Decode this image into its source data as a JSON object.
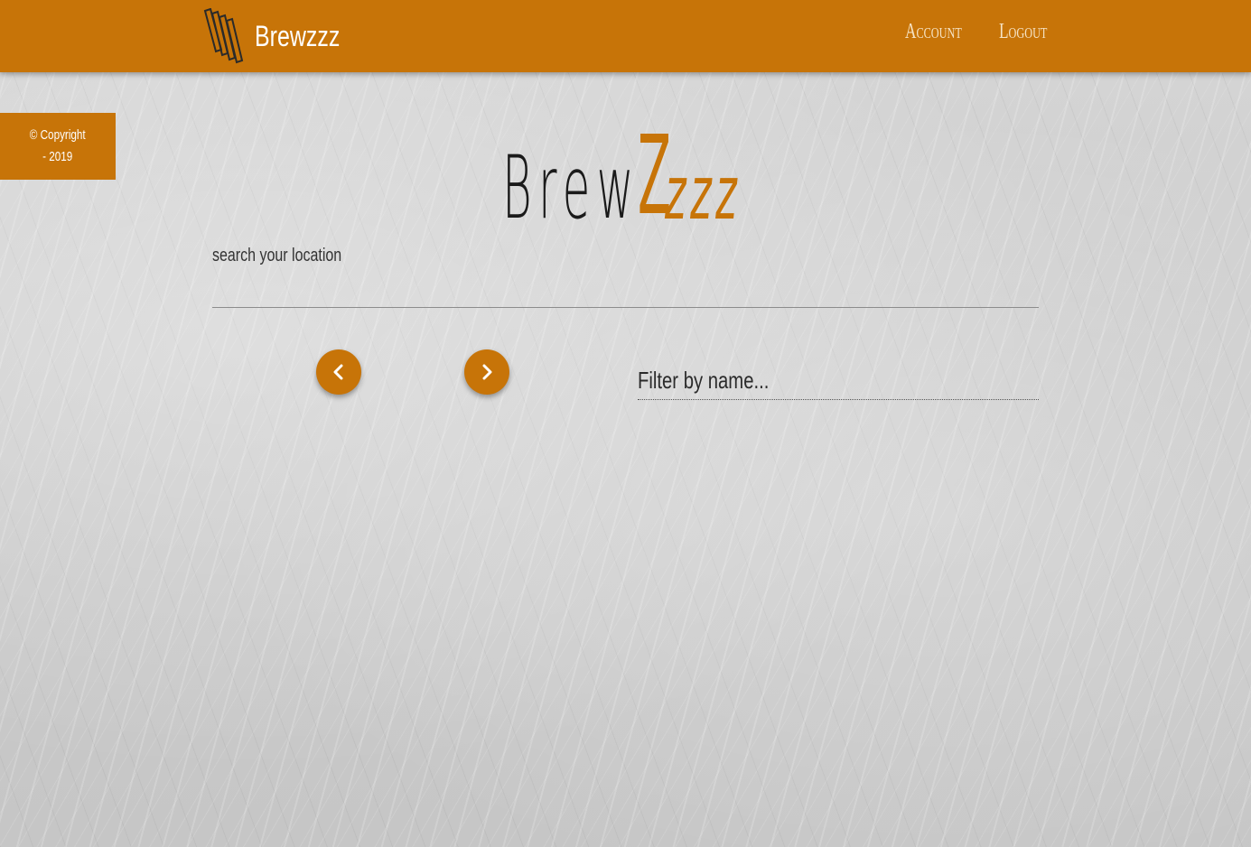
{
  "navbar": {
    "brand_name": "Brewzzz",
    "brand_logo_icon": "striped-logo-icon",
    "links": [
      {
        "label": "Account"
      },
      {
        "label": "Logout"
      }
    ]
  },
  "sidebar": {
    "copyright_line1": "© Copyright",
    "copyright_line2": "- 2019"
  },
  "hero": {
    "brew": "Brew",
    "z": "Z",
    "zzz": "zzz"
  },
  "search": {
    "label": "search your location",
    "value": ""
  },
  "pager": {
    "prev_icon": "chevron-left-icon",
    "next_icon": "chevron-right-icon"
  },
  "filter": {
    "placeholder": "Filter by name...",
    "value": ""
  },
  "colors": {
    "accent": "#c77408",
    "nav_link": "#f6e3c4",
    "text_dark": "#1a1a1a"
  }
}
